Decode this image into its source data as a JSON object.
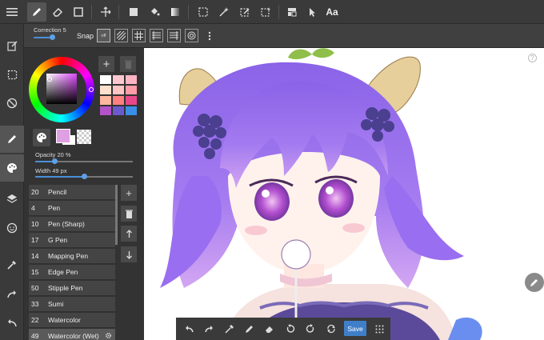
{
  "toolbar": {
    "text_tool_label": "Aa"
  },
  "subbar": {
    "correction_label": "Correction 5",
    "correction_value": 5,
    "correction_fraction": 0.55,
    "snap_label": "Snap",
    "snap_off_label": "off"
  },
  "color": {
    "current_color": "#dfa0e3",
    "background_color": "#ffffff",
    "swatches": [
      "#ffffff",
      "#ffc6d0",
      "#ffb4c4",
      "#ffe0cc",
      "#ffc4c4",
      "#ff9ca8",
      "#ffb8a0",
      "#ff8080",
      "#e8488a",
      "#b452c8",
      "#6a5acd",
      "#3a8ee6"
    ]
  },
  "params": {
    "opacity_label": "Opacity 20 %",
    "opacity_fraction": 0.2,
    "width_label": "Width 49 px",
    "width_fraction": 0.5
  },
  "brushes": [
    {
      "size": "20",
      "name": "Pencil"
    },
    {
      "size": "4",
      "name": "Pen"
    },
    {
      "size": "10",
      "name": "Pen (Sharp)"
    },
    {
      "size": "17",
      "name": "G Pen"
    },
    {
      "size": "14",
      "name": "Mapping Pen"
    },
    {
      "size": "15",
      "name": "Edge Pen"
    },
    {
      "size": "50",
      "name": "Stipple Pen"
    },
    {
      "size": "33",
      "name": "Sumi"
    },
    {
      "size": "22",
      "name": "Watercolor"
    },
    {
      "size": "49",
      "name": "Watercolor (Wet)"
    }
  ],
  "bottombar": {
    "save_label": "Save"
  },
  "canvas": {
    "help_label": "?"
  },
  "colors": {
    "accent": "#3f7fc9",
    "toolbar_bg": "#3a3a3a",
    "panel_bg": "#333333",
    "selected_brush": "#5a5a5a"
  }
}
